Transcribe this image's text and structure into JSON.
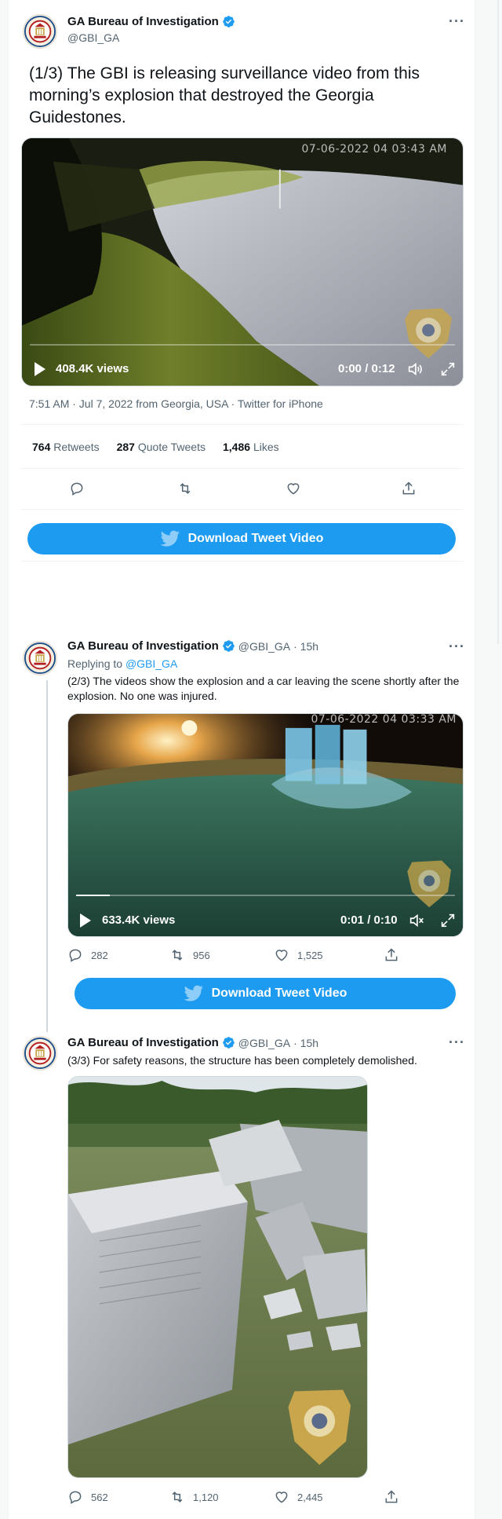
{
  "account": {
    "name": "GA Bureau of Investigation",
    "handle": "@GBI_GA"
  },
  "tweet1": {
    "text": "(1/3) The GBI is releasing surveillance video from this morning’s explosion that destroyed the Georgia Guidestones.",
    "video": {
      "timestamp": "07-06-2022 04 03:43 AM",
      "views": "408.4K views",
      "time": "0:00 / 0:12",
      "progress": 0.0
    },
    "meta": "7:51 AM · Jul 7, 2022 from Georgia, USA · Twitter for iPhone",
    "stats": {
      "retweets_count": "764",
      "retweets_label": "Retweets",
      "quotes_count": "287",
      "quotes_label": "Quote Tweets",
      "likes_count": "1,486",
      "likes_label": "Likes"
    }
  },
  "download_label": "Download Tweet Video",
  "tweet2": {
    "time": "· 15h",
    "replying_prefix": "Replying to",
    "replying_handle": "@GBI_GA",
    "text": "(2/3) The videos show the explosion and a car leaving the scene shortly after the explosion.  No one was injured.",
    "video": {
      "timestamp": "07-06-2022 04 03:33 AM",
      "views": "633.4K views",
      "time": "0:01 / 0:10",
      "progress": 0.09
    },
    "replies": "282",
    "retweets": "956",
    "likes": "1,525"
  },
  "tweet3": {
    "time": "· 15h",
    "text": "(3/3) For safety reasons, the structure has been completely demolished.",
    "replies": "562",
    "retweets": "1,120",
    "likes": "2,445"
  },
  "colors": {
    "accent": "#1d9bf0",
    "text": "#0f1419",
    "muted": "#536471"
  }
}
